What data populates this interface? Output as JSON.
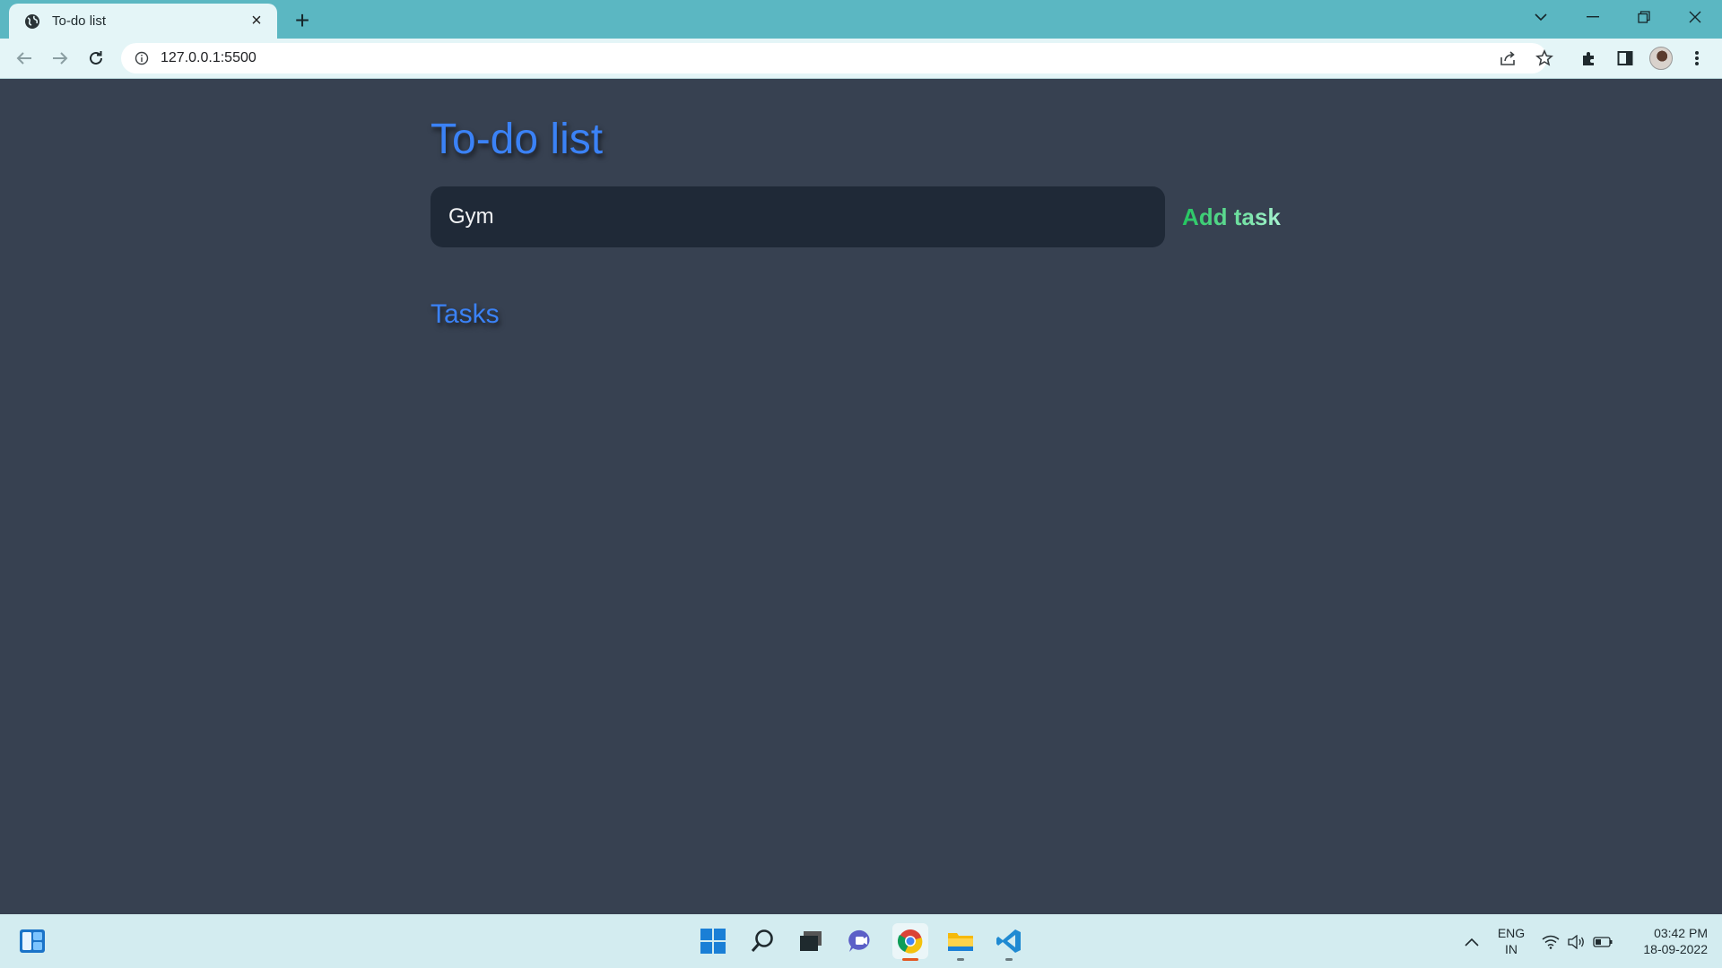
{
  "browser": {
    "tab_title": "To-do list",
    "address": "127.0.0.1:5500"
  },
  "app": {
    "title": "To-do list",
    "input_value": "Gym",
    "add_button_label": "Add task",
    "tasks_heading": "Tasks"
  },
  "taskbar": {
    "lang_top": "ENG",
    "lang_bottom": "IN",
    "time": "03:42 PM",
    "date": "18-09-2022",
    "apps": [
      "start-icon",
      "search-icon",
      "task-view-icon",
      "chat-icon",
      "chrome-icon",
      "file-explorer-icon",
      "vscode-icon"
    ]
  },
  "colors": {
    "page_background": "#374151",
    "heading_blue": "#3b82f6",
    "input_background": "#1f2937",
    "add_button_green": "#22c55e",
    "tabstrip": "#5bb7c2",
    "toolbar": "#e4f5f7",
    "taskbar": "#d3ecf0"
  }
}
